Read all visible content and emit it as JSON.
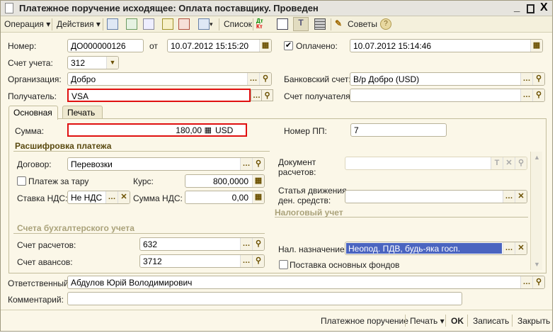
{
  "window": {
    "title": "Платежное поручение исходящее: Оплата поставщику. Проведен"
  },
  "toolbar": {
    "operation": "Операция",
    "actions": "Действия",
    "list": "Список",
    "tips": "Советы"
  },
  "form": {
    "number_label": "Номер:",
    "number": "ДО000000126",
    "from_label": "от",
    "date": "10.07.2012 15:15:20",
    "paid_label": "Оплачено:",
    "paid_checked": true,
    "paid_date": "10.07.2012 15:14:46",
    "account_label": "Счет учета:",
    "account": "312",
    "org_label": "Организация:",
    "org": "Добро",
    "bank_label": "Банковский счет:",
    "bank": "В/р Добро (USD)",
    "recipient_label": "Получатель:",
    "recipient": "VSA",
    "recipient_account_label": "Счет получателя:",
    "recipient_account": ""
  },
  "tabs": [
    {
      "label": "Основная",
      "active": true
    },
    {
      "label": "Печать",
      "active": false
    }
  ],
  "main": {
    "sum_label": "Сумма:",
    "sum": "180,00",
    "currency": "USD",
    "pp_label": "Номер ПП:",
    "pp": "7",
    "breakdown_header": "Расшифровка платежа",
    "contract_label": "Договор:",
    "contract": "Перевозки",
    "tare_label": "Платеж за тару",
    "tare_checked": false,
    "rate_label": "Курс:",
    "rate": "800,0000",
    "vat_rate_label": "Ставка НДС:",
    "vat_rate": "Не НДС",
    "vat_sum_label": "Сумма НДС:",
    "vat_sum": "0,00",
    "accounts_header": "Счета бухгалтерского учета",
    "settle_label": "Счет расчетов:",
    "settle": "632",
    "advance_label": "Счет авансов:",
    "advance": "3712",
    "doc_label_1": "Документ",
    "doc_label_2": "расчетов:",
    "doc": "",
    "cash_label_1": "Статья движения",
    "cash_label_2": "ден. средств:",
    "cash": "",
    "tax_header": "Налоговый учет",
    "tax_purpose_label": "Нал. назначение:",
    "tax_purpose": "Неопод. ПДВ, будь-яка госп.",
    "fixed_assets_label": "Поставка основных фондов",
    "fixed_assets_checked": false
  },
  "responsible_label": "Ответственный:",
  "responsible": "Абдулов Юрій Володимирович",
  "comment_label": "Комментарий:",
  "comment": "",
  "bottom": {
    "print_order": "Платежное поручение",
    "print": "Печать",
    "ok": "OK",
    "save": "Записать",
    "close": "Закрыть"
  }
}
